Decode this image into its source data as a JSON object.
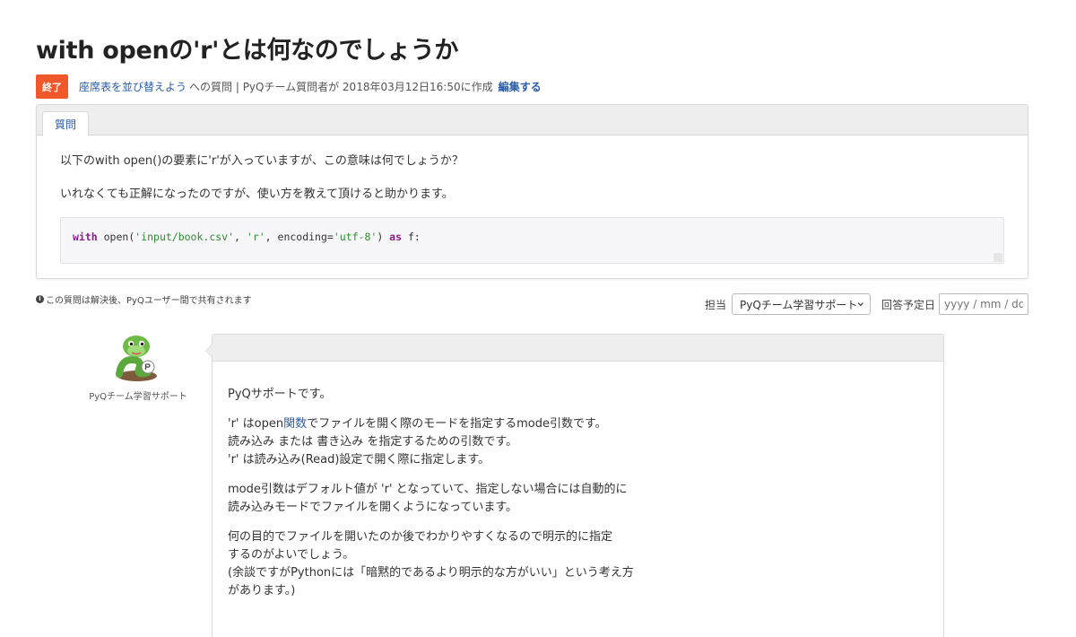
{
  "title": "with openの'r'とは何なのでしょうか",
  "meta": {
    "status": "終了",
    "course_link": "座席表を並び替えよう",
    "meta_text": "への質問 | PyQチーム質問者が 2018年03月12日16:50に作成",
    "edit": "編集する"
  },
  "question": {
    "tab": "質問",
    "lines": [
      "以下のwith open()の要素に'r'が入っていますが、この意味は何でしょうか？",
      "いれなくても正解になったのですが、使い方を教えて頂けると助かります。"
    ],
    "code": {
      "kw1": "with",
      "p1": " open(",
      "s1": "'input/book.csv'",
      "p2": ", ",
      "s2": "'r'",
      "p3": ", encoding=",
      "s3": "'utf-8'",
      "p4": ") ",
      "kw2": "as",
      "p5": " f:"
    }
  },
  "share_note": "この質問は解決後、PyQユーザー間で共有されます",
  "assign": {
    "label": "担当",
    "selected": "PyQチーム学習サポート",
    "due_label": "回答予定日",
    "due_placeholder": "yyyy / mm / dd"
  },
  "answer": {
    "author": "PyQチーム学習サポート",
    "p1": "PyQサポートです。",
    "p2": {
      "l1_pre": "'r' はopen",
      "l1_link": "関数",
      "l1_post": "でファイルを開く際のモードを指定するmode引数です。",
      "l2": "読み込み または 書き込み を指定するための引数です。",
      "l3": "'r' は読み込み(Read)設定で開く際に指定します。"
    },
    "p3": {
      "l1": "mode引数はデフォルト値が 'r' となっていて、指定しない場合には自動的に",
      "l2": "読み込みモードでファイルを開くようになっています。"
    },
    "p4": {
      "l1": "何の目的でファイルを開いたのか後でわかりやすくなるので明示的に指定",
      "l2": "するのがよいでしょう。",
      "l3": "(余談ですがPythonには「暗黙的であるより明示的な方がいい」という考え方",
      "l4": "があります。)"
    }
  },
  "colors": {
    "accent": "#2a5ca8",
    "status": "#f0572b",
    "keyword": "#8c1a8c",
    "string": "#2e8b2e"
  }
}
